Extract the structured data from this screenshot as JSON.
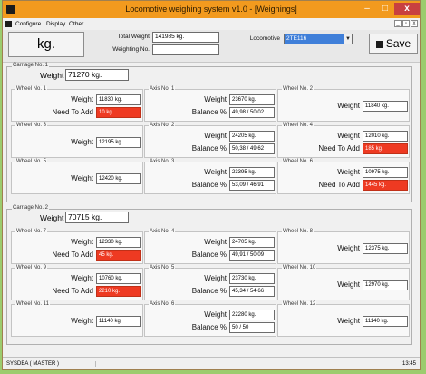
{
  "window": {
    "title": "Locomotive weighing system v1.0 - [Weighings]",
    "minimize_glyph": "–",
    "maximize_glyph": "□",
    "close_glyph": "x"
  },
  "menu": {
    "items": [
      "Configure",
      "Display",
      "Other"
    ],
    "mdi_controls": [
      "_",
      "▫",
      "x"
    ]
  },
  "toolbar": {
    "unit_button": "kg.",
    "total_weight_label": "Total Weight",
    "total_weight_value": "141985 kg.",
    "weighting_no_label": "Weighting No.",
    "weighting_no_value": "",
    "locomotive_label": "Locomotive",
    "locomotive_value": "2TE116",
    "locomotive_dropdown": "▼",
    "save_label": "Save"
  },
  "icons": [
    "app-icon",
    "menu-app-icon",
    "save-icon",
    "dropdown-arrow-icon"
  ],
  "colors": {
    "titlebar": "#f29a1e",
    "alert_red": "#ee3a22",
    "selected_blue": "#3f7fd9"
  },
  "labels": {
    "weight": "Weight",
    "need_to_add": "Need To Add",
    "balance": "Balance %"
  },
  "carriages": [
    {
      "label": "Carriage No. 1",
      "weight": "71270 kg.",
      "rows": [
        {
          "left": {
            "label": "Wheel No. 1",
            "weight": "11830 kg.",
            "need": "10 kg."
          },
          "axis": {
            "label": "Axis No. 1",
            "weight": "23670 kg.",
            "balance": "49,98 / 50,02"
          },
          "right": {
            "label": "Wheel No. 2",
            "weight": "11840 kg.",
            "need": ""
          }
        },
        {
          "left": {
            "label": "Wheel No. 3",
            "weight": "12195 kg.",
            "need": ""
          },
          "axis": {
            "label": "Axis No. 2",
            "weight": "24205 kg.",
            "balance": "50,38 / 49,62"
          },
          "right": {
            "label": "Wheel No. 4",
            "weight": "12010 kg.",
            "need": "185 kg."
          }
        },
        {
          "left": {
            "label": "Wheel No. 5",
            "weight": "12420 kg.",
            "need": ""
          },
          "axis": {
            "label": "Axis No. 3",
            "weight": "23395 kg.",
            "balance": "53,09 / 46,91"
          },
          "right": {
            "label": "Wheel No. 6",
            "weight": "10975 kg.",
            "need": "1445 kg."
          }
        }
      ]
    },
    {
      "label": "Carriage No. 2",
      "weight": "70715 kg.",
      "rows": [
        {
          "left": {
            "label": "Wheel No. 7",
            "weight": "12330 kg.",
            "need": "45 kg."
          },
          "axis": {
            "label": "Axis No. 4",
            "weight": "24705 kg.",
            "balance": "49,91 / 50,09"
          },
          "right": {
            "label": "Wheel No. 8",
            "weight": "12375 kg.",
            "need": ""
          }
        },
        {
          "left": {
            "label": "Wheel No. 9",
            "weight": "10760 kg.",
            "need": "2210 kg."
          },
          "axis": {
            "label": "Axis No. 5",
            "weight": "23730 kg.",
            "balance": "45,34 / 54,66"
          },
          "right": {
            "label": "Wheel No. 10",
            "weight": "12970 kg.",
            "need": ""
          }
        },
        {
          "left": {
            "label": "Wheel No. 11",
            "weight": "11140 kg.",
            "need": ""
          },
          "axis": {
            "label": "Axis No. 6",
            "weight": "22280 kg.",
            "balance": "50 / 50"
          },
          "right": {
            "label": "Wheel No. 12",
            "weight": "11140 kg.",
            "need": ""
          }
        }
      ]
    }
  ],
  "status": {
    "user": "SYSDBA ( MASTER )",
    "time": "13:45"
  }
}
